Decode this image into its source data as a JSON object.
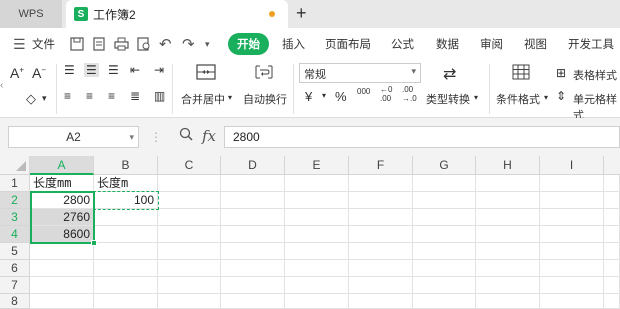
{
  "tabs": {
    "app": "WPS",
    "document": "工作簿2",
    "new_tab": "+"
  },
  "menu": {
    "file": "文件",
    "start": "开始",
    "insert": "插入",
    "page_layout": "页面布局",
    "formula": "公式",
    "data": "数据",
    "review": "审阅",
    "view": "视图",
    "dev_tools": "开发工具"
  },
  "ribbon": {
    "font_name": "常规",
    "merge_center": "合并居中",
    "wrap_text": "自动换行",
    "currency": "¥",
    "percent": "%",
    "thousands": "000",
    "inc_decimal": "←0\n.00",
    "dec_decimal": ".00\n→.0",
    "type_convert": "类型转换",
    "conditional_format": "条件格式",
    "table_style": "表格样式",
    "cell_style": "单元格样式"
  },
  "formula_bar": {
    "name_box": "A2",
    "fx": "fx",
    "value": "2800"
  },
  "columns": [
    "A",
    "B",
    "C",
    "D",
    "E",
    "F",
    "G",
    "H",
    "I"
  ],
  "rows": [
    "1",
    "2",
    "3",
    "4",
    "5",
    "6",
    "7",
    "8"
  ],
  "cells": {
    "A1": "长度mm",
    "B1": "长度m",
    "A2": "2800",
    "B2": "100",
    "A3": "2760",
    "A4": "8600"
  },
  "colors": {
    "accent": "#1aaf5d",
    "selection_fill": "#d9d9d9"
  }
}
